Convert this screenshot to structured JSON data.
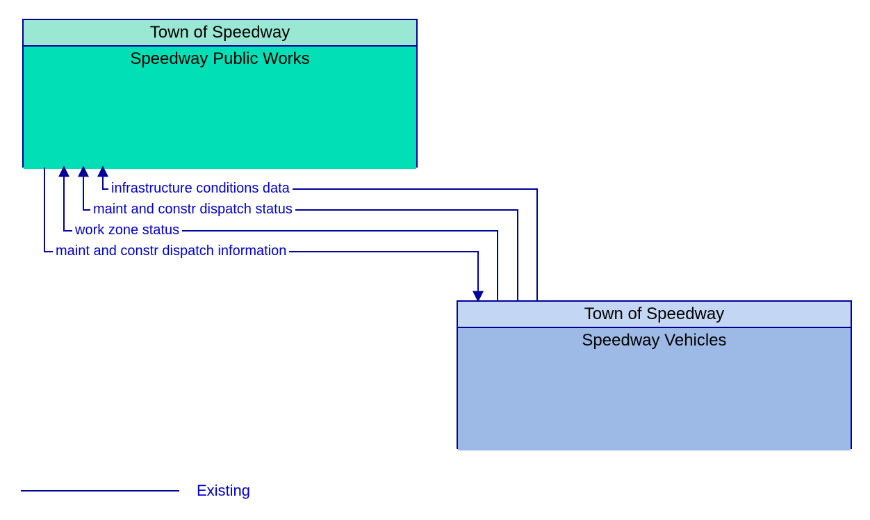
{
  "boxes": {
    "publicWorks": {
      "header": "Town of Speedway",
      "body": "Speedway Public Works",
      "headerFill": "#9ae8d3",
      "bodyFill": "#00dfb5"
    },
    "vehicles": {
      "header": "Town of Speedway",
      "body": "Speedway Vehicles",
      "headerFill": "#c3d6f3",
      "bodyFill": "#9db9e6"
    }
  },
  "flows": {
    "f1": "infrastructure conditions data",
    "f2": "maint and constr dispatch status",
    "f3": "work zone status",
    "f4": "maint and constr dispatch information"
  },
  "legend": {
    "existing": "Existing"
  },
  "colors": {
    "line": "#000099",
    "text": "#0000cc"
  }
}
